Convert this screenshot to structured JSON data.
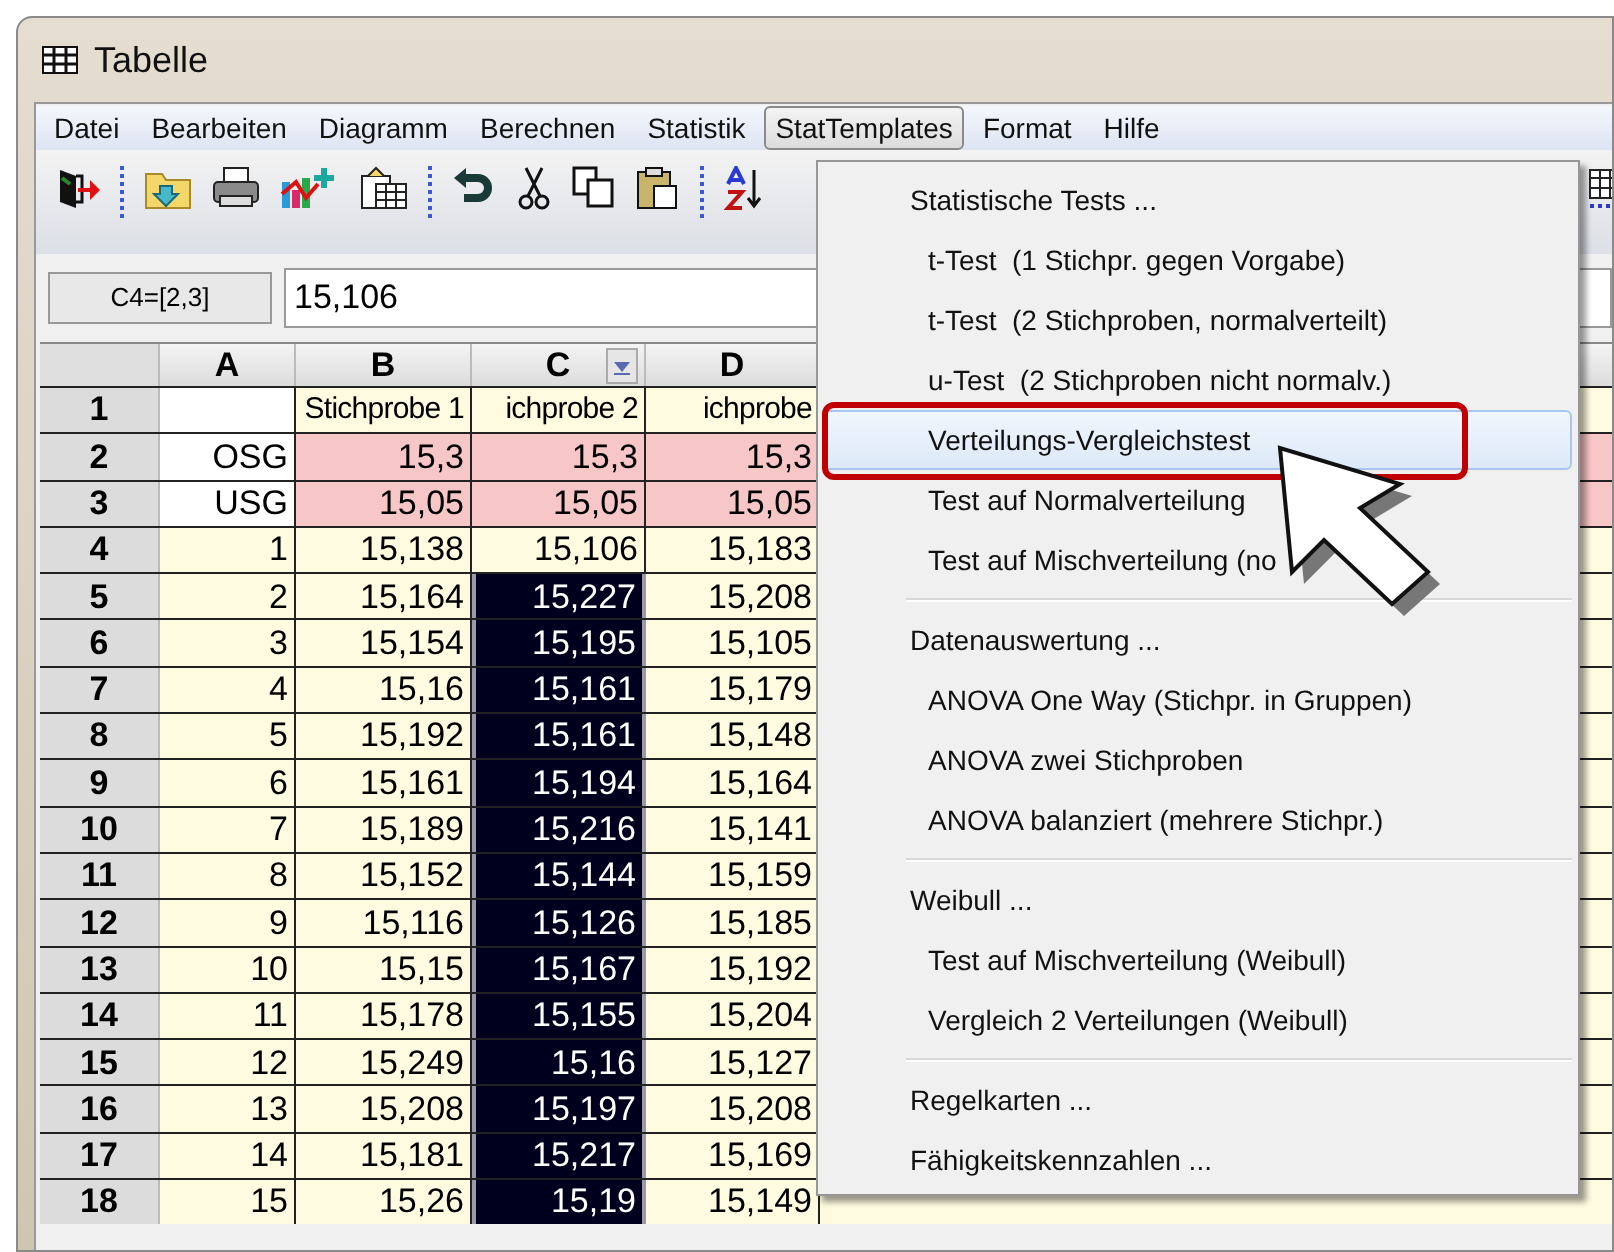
{
  "window": {
    "title": "Tabelle"
  },
  "menu_bar": [
    {
      "label": "Datei",
      "selected": false
    },
    {
      "label": "Bearbeiten",
      "selected": false
    },
    {
      "label": "Diagramm",
      "selected": false
    },
    {
      "label": "Berechnen",
      "selected": false
    },
    {
      "label": "Statistik",
      "selected": false
    },
    {
      "label": "StatTemplates",
      "selected": true
    },
    {
      "label": "Format",
      "selected": false
    },
    {
      "label": "Hilfe",
      "selected": false
    }
  ],
  "name_box": "C4=[2,3]",
  "formula": "15,106",
  "columns": [
    {
      "label": "A",
      "filter": false
    },
    {
      "label": "B",
      "filter": false
    },
    {
      "label": "C",
      "filter": true
    },
    {
      "label": "D",
      "filter": false
    }
  ],
  "rows": [
    {
      "number": "1",
      "kind": "title",
      "cells": [
        {
          "selected": false
        },
        {
          "text": "Stichprobe 1",
          "selected": false
        },
        {
          "text": "ichprobe 2",
          "selected": false
        },
        {
          "text": "ichprobe",
          "selected": false
        }
      ]
    },
    {
      "number": "2",
      "kind": "limit",
      "cells": [
        {
          "text": "OSG",
          "selected": false
        },
        {
          "text": "15,3",
          "selected": false
        },
        {
          "text": "15,3",
          "selected": false
        },
        {
          "text": "15,3",
          "selected": false
        }
      ]
    },
    {
      "number": "3",
      "kind": "limit",
      "cells": [
        {
          "text": "USG",
          "selected": false
        },
        {
          "text": "15,05",
          "selected": false
        },
        {
          "text": "15,05",
          "selected": false
        },
        {
          "text": "15,05",
          "selected": false
        }
      ]
    },
    {
      "number": "4",
      "kind": "data",
      "cells": [
        {
          "text": "1",
          "selected": false
        },
        {
          "text": "15,138",
          "selected": false
        },
        {
          "text": "15,106",
          "selected": false
        },
        {
          "text": "15,183",
          "selected": false
        }
      ]
    },
    {
      "number": "5",
      "kind": "data",
      "cells": [
        {
          "text": "2",
          "selected": false
        },
        {
          "text": "15,164",
          "selected": false
        },
        {
          "text": "15,227",
          "selected": true
        },
        {
          "text": "15,208",
          "selected": false
        }
      ]
    },
    {
      "number": "6",
      "kind": "data",
      "cells": [
        {
          "text": "3",
          "selected": false
        },
        {
          "text": "15,154",
          "selected": false
        },
        {
          "text": "15,195",
          "selected": true
        },
        {
          "text": "15,105",
          "selected": false
        }
      ]
    },
    {
      "number": "7",
      "kind": "data",
      "cells": [
        {
          "text": "4",
          "selected": false
        },
        {
          "text": "15,16",
          "selected": false
        },
        {
          "text": "15,161",
          "selected": true
        },
        {
          "text": "15,179",
          "selected": false
        }
      ]
    },
    {
      "number": "8",
      "kind": "data",
      "cells": [
        {
          "text": "5",
          "selected": false
        },
        {
          "text": "15,192",
          "selected": false
        },
        {
          "text": "15,161",
          "selected": true
        },
        {
          "text": "15,148",
          "selected": false
        }
      ]
    },
    {
      "number": "9",
      "kind": "data",
      "cells": [
        {
          "text": "6",
          "selected": false
        },
        {
          "text": "15,161",
          "selected": false
        },
        {
          "text": "15,194",
          "selected": true
        },
        {
          "text": "15,164",
          "selected": false
        }
      ]
    },
    {
      "number": "10",
      "kind": "data",
      "cells": [
        {
          "text": "7",
          "selected": false
        },
        {
          "text": "15,189",
          "selected": false
        },
        {
          "text": "15,216",
          "selected": true
        },
        {
          "text": "15,141",
          "selected": false
        }
      ]
    },
    {
      "number": "11",
      "kind": "data",
      "cells": [
        {
          "text": "8",
          "selected": false
        },
        {
          "text": "15,152",
          "selected": false
        },
        {
          "text": "15,144",
          "selected": true
        },
        {
          "text": "15,159",
          "selected": false
        }
      ]
    },
    {
      "number": "12",
      "kind": "data",
      "cells": [
        {
          "text": "9",
          "selected": false
        },
        {
          "text": "15,116",
          "selected": false
        },
        {
          "text": "15,126",
          "selected": true
        },
        {
          "text": "15,185",
          "selected": false
        }
      ]
    },
    {
      "number": "13",
      "kind": "data",
      "cells": [
        {
          "text": "10",
          "selected": false
        },
        {
          "text": "15,15",
          "selected": false
        },
        {
          "text": "15,167",
          "selected": true
        },
        {
          "text": "15,192",
          "selected": false
        }
      ]
    },
    {
      "number": "14",
      "kind": "data",
      "cells": [
        {
          "text": "11",
          "selected": false
        },
        {
          "text": "15,178",
          "selected": false
        },
        {
          "text": "15,155",
          "selected": true
        },
        {
          "text": "15,204",
          "selected": false
        }
      ]
    },
    {
      "number": "15",
      "kind": "data",
      "cells": [
        {
          "text": "12",
          "selected": false
        },
        {
          "text": "15,249",
          "selected": false
        },
        {
          "text": "15,16",
          "selected": true
        },
        {
          "text": "15,127",
          "selected": false
        }
      ]
    },
    {
      "number": "16",
      "kind": "data",
      "cells": [
        {
          "text": "13",
          "selected": false
        },
        {
          "text": "15,208",
          "selected": false
        },
        {
          "text": "15,197",
          "selected": true
        },
        {
          "text": "15,208",
          "selected": false
        }
      ]
    },
    {
      "number": "17",
      "kind": "data",
      "cells": [
        {
          "text": "14",
          "selected": false
        },
        {
          "text": "15,181",
          "selected": false
        },
        {
          "text": "15,217",
          "selected": true
        },
        {
          "text": "15,169",
          "selected": false
        }
      ]
    },
    {
      "number": "18",
      "kind": "data",
      "cells": [
        {
          "text": "15",
          "selected": false
        },
        {
          "text": "15,26",
          "selected": false
        },
        {
          "text": "15,19",
          "selected": true
        },
        {
          "text": "15,149",
          "selected": false
        }
      ]
    }
  ],
  "dropdown": {
    "entries": [
      {
        "kind": "heading",
        "label": "Statistische Tests ...",
        "selected": false
      },
      {
        "kind": "item",
        "label": "t-Test  (1 Stichpr. gegen Vorgabe)",
        "selected": false
      },
      {
        "kind": "item",
        "label": "t-Test  (2 Stichproben, normalverteilt)",
        "selected": false
      },
      {
        "kind": "item",
        "label": "u-Test  (2 Stichproben nicht normalv.)",
        "selected": false
      },
      {
        "kind": "item",
        "label": "Verteilungs-Vergleichstest",
        "selected": true
      },
      {
        "kind": "item",
        "label": "Test auf Normalverteilung",
        "selected": false
      },
      {
        "kind": "item",
        "label": "Test auf Mischverteilung (no",
        "selected": false
      },
      {
        "kind": "separator"
      },
      {
        "kind": "heading",
        "label": "Datenauswertung ...",
        "selected": false
      },
      {
        "kind": "item",
        "label": "ANOVA One Way (Stichpr. in Gruppen)",
        "selected": false
      },
      {
        "kind": "item",
        "label": "ANOVA zwei Stichproben",
        "selected": false
      },
      {
        "kind": "item",
        "label": "ANOVA balanziert (mehrere Stichpr.)",
        "selected": false
      },
      {
        "kind": "separator"
      },
      {
        "kind": "heading",
        "label": "Weibull ...",
        "selected": false
      },
      {
        "kind": "item",
        "label": "Test auf Mischverteilung (Weibull)",
        "selected": false
      },
      {
        "kind": "item",
        "label": "Vergleich 2 Verteilungen (Weibull)",
        "selected": false
      },
      {
        "kind": "separator"
      },
      {
        "kind": "heading",
        "label": "Regelkarten ...",
        "selected": false
      },
      {
        "kind": "heading",
        "label": "Fähigkeitskennzahlen ...",
        "selected": false
      }
    ]
  }
}
